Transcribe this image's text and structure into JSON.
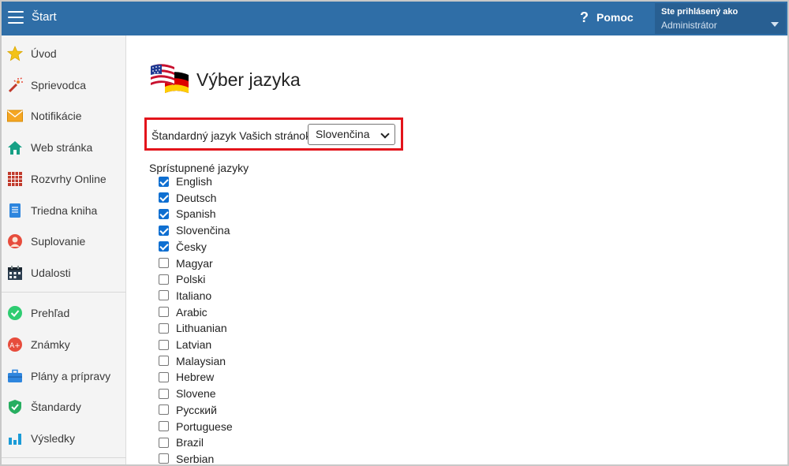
{
  "header": {
    "title": "Štart",
    "help_label": "Pomoc",
    "user_caption": "Ste prihlásený ako",
    "user_name": "Administrátor"
  },
  "sidebar": {
    "items": [
      {
        "label": "Úvod",
        "icon": "star-icon"
      },
      {
        "label": "Sprievodca",
        "icon": "magic-wand-icon"
      },
      {
        "label": "Notifikácie",
        "icon": "envelope-icon"
      },
      {
        "label": "Web stránka",
        "icon": "house-icon"
      },
      {
        "label": "Rozvrhy Online",
        "icon": "timetable-grid-icon"
      },
      {
        "label": "Triedna kniha",
        "icon": "notebook-icon"
      },
      {
        "label": "Suplovanie",
        "icon": "person-icon"
      },
      {
        "label": "Udalosti",
        "icon": "calendar-icon"
      },
      {
        "label": "Prehľad",
        "icon": "checkmark-circle-icon"
      },
      {
        "label": "Známky",
        "icon": "grade-badge-icon"
      },
      {
        "label": "Plány a prípravy",
        "icon": "briefcase-icon"
      },
      {
        "label": "Štandardy",
        "icon": "shield-check-icon"
      },
      {
        "label": "Výsledky",
        "icon": "bar-chart-icon"
      }
    ]
  },
  "main": {
    "title": "Výber jazyka",
    "default_language_label": "Štandardný jazyk Vašich stránok",
    "default_language_value": "Slovenčina",
    "enabled_languages_label": "Sprístupnené jazyky",
    "languages": [
      {
        "name": "English",
        "checked": true
      },
      {
        "name": "Deutsch",
        "checked": true
      },
      {
        "name": "Spanish",
        "checked": true
      },
      {
        "name": "Slovenčina",
        "checked": true
      },
      {
        "name": "Česky",
        "checked": true
      },
      {
        "name": "Magyar",
        "checked": false
      },
      {
        "name": "Polski",
        "checked": false
      },
      {
        "name": "Italiano",
        "checked": false
      },
      {
        "name": "Arabic",
        "checked": false
      },
      {
        "name": "Lithuanian",
        "checked": false
      },
      {
        "name": "Latvian",
        "checked": false
      },
      {
        "name": "Malaysian",
        "checked": false
      },
      {
        "name": "Hebrew",
        "checked": false
      },
      {
        "name": "Slovene",
        "checked": false
      },
      {
        "name": "Русский",
        "checked": false
      },
      {
        "name": "Portuguese",
        "checked": false
      },
      {
        "name": "Brazil",
        "checked": false
      },
      {
        "name": "Serbian",
        "checked": false
      }
    ]
  },
  "colors": {
    "header_bg": "#2f6ea7",
    "highlight_border": "#e3141b",
    "checkbox_on": "#0f6fd1"
  }
}
